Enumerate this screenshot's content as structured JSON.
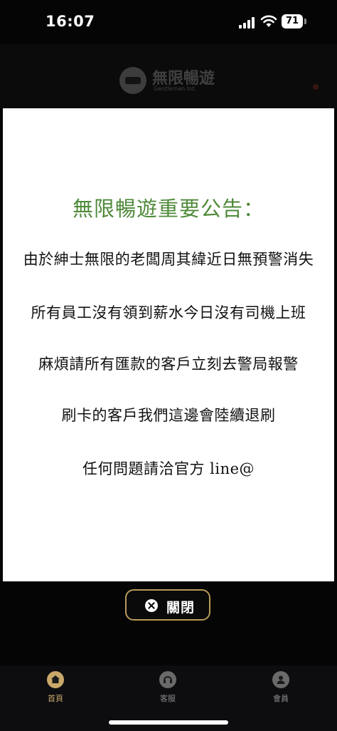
{
  "status_bar": {
    "time": "16:07",
    "battery": "71",
    "icons": [
      "signal-icon",
      "wifi-icon",
      "battery-icon"
    ]
  },
  "header": {
    "logo_title": "無限暢遊",
    "logo_subtitle": "Gentleman Int."
  },
  "notice": {
    "title": "無限暢遊重要公告：",
    "lines": [
      "由於紳士無限的老闆周其緯近日無預警消失",
      "所有員工沒有領到薪水今日沒有司機上班",
      "麻煩請所有匯款的客戶立刻去警局報警",
      "刷卡的客戶我們這邊會陸續退刷",
      "任何問題請洽官方 line@"
    ],
    "title_color": "#4f8a3a"
  },
  "close_button": {
    "label": "關閉",
    "icon": "close-icon",
    "border_color": "#b89a5a"
  },
  "bottom_nav": {
    "items": [
      {
        "label": "首頁",
        "icon": "home-icon",
        "active": true
      },
      {
        "label": "客服",
        "icon": "headset-icon",
        "active": false
      },
      {
        "label": "會員",
        "icon": "person-icon",
        "active": false
      }
    ],
    "accent_color": "#c9a86a"
  }
}
